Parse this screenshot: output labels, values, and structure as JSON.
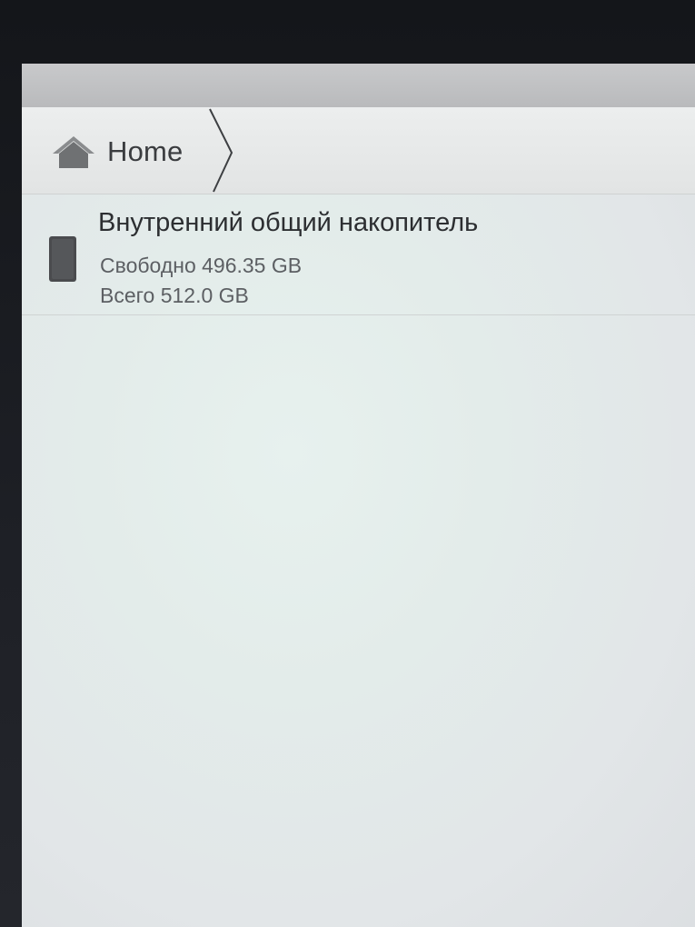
{
  "breadcrumb": {
    "home_label": "Home",
    "icon": "home-icon"
  },
  "storage": {
    "icon": "phone-storage-icon",
    "title": "Внутренний общий накопитель",
    "free": "Свободно 496.35 GB",
    "total": "Всего 512.0 GB"
  },
  "colors": {
    "breadcrumb_bg": "#e6e8e8",
    "title_text": "#2c2e31",
    "secondary_text": "#5c5f63",
    "device_icon": "#4a4b4e"
  }
}
